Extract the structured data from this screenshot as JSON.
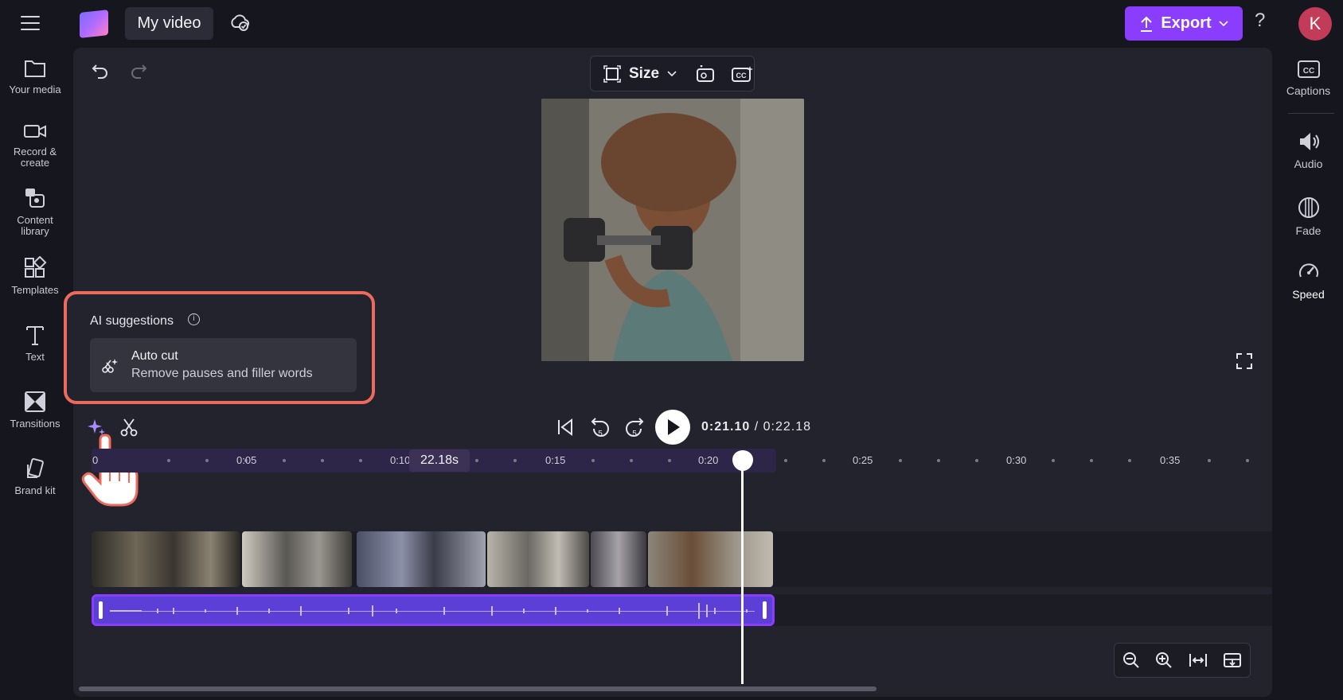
{
  "header": {
    "menu_icon": "hamburger-menu-icon",
    "project_title": "My video",
    "sync_icon": "cloud-check-icon",
    "export_label": "Export",
    "help_label": "?",
    "avatar_initial": "K"
  },
  "left_sidebar": {
    "items": [
      {
        "label": "Your media",
        "icon": "folder-icon"
      },
      {
        "label": "Record &\ncreate",
        "icon": "camera-icon"
      },
      {
        "label": "Content\nlibrary",
        "icon": "library-icon"
      },
      {
        "label": "Templates",
        "icon": "templates-icon"
      },
      {
        "label": "Text",
        "icon": "text-icon"
      },
      {
        "label": "Transitions",
        "icon": "transitions-icon"
      },
      {
        "label": "Brand kit",
        "icon": "brand-kit-icon"
      }
    ]
  },
  "right_sidebar": {
    "items": [
      {
        "label": "Captions",
        "icon": "captions-icon"
      },
      {
        "label": "Audio",
        "icon": "audio-icon"
      },
      {
        "label": "Fade",
        "icon": "fade-icon"
      },
      {
        "label": "Speed",
        "icon": "speed-icon"
      }
    ]
  },
  "preview": {
    "size_label": "Size"
  },
  "ai_suggestions": {
    "header": "AI suggestions",
    "info_glyph": "i",
    "item_title": "Auto cut",
    "item_description": "Remove pauses and filler words"
  },
  "playback": {
    "current_time": "0:21.10",
    "separator": "/",
    "total_time": "0:22.18"
  },
  "timeline": {
    "ruler_labels": [
      "0",
      "0:05",
      "0:10",
      "0:15",
      "0:20",
      "0:25",
      "0:30",
      "0:35"
    ],
    "duration_badge": "22.18s",
    "clip_count": 6
  },
  "colors": {
    "accent": "#8b3dff",
    "highlight_border": "#ec6b5e",
    "panel": "#23232e",
    "background": "#16161e"
  }
}
